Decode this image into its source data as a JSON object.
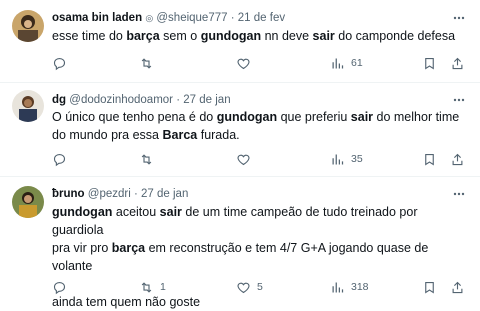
{
  "tweets": [
    {
      "name": "osama bin laden",
      "handle": "@sheique777",
      "sep": "·",
      "date": "21 de fev",
      "body_parts": [
        {
          "t": "esse time do ",
          "b": false
        },
        {
          "t": "barça",
          "b": true
        },
        {
          "t": " sem o ",
          "b": false
        },
        {
          "t": "gundogan",
          "b": true
        },
        {
          "t": " nn deve ",
          "b": false
        },
        {
          "t": "sair",
          "b": true
        },
        {
          "t": " do camponde defesa",
          "b": false
        }
      ],
      "replies": "",
      "retweets": "",
      "likes": "",
      "views": "61"
    },
    {
      "name": "dg",
      "handle": "@dodozinhodoamor",
      "sep": "·",
      "date": "27 de jan",
      "line1": [
        {
          "t": "O único que tenho pena é do ",
          "b": false
        },
        {
          "t": "gundogan",
          "b": true
        },
        {
          "t": " que preferiu ",
          "b": false
        },
        {
          "t": "sair",
          "b": true
        },
        {
          "t": " do melhor time",
          "b": false
        }
      ],
      "line2": [
        {
          "t": "do mundo pra essa ",
          "b": false
        },
        {
          "t": "Barca",
          "b": true
        },
        {
          "t": "  furada.",
          "b": false
        }
      ],
      "replies": "",
      "retweets": "",
      "likes": "",
      "views": "35"
    },
    {
      "name": "ƀruno",
      "handle": "@pezdri",
      "sep": "·",
      "date": "27 de jan",
      "line1": [
        {
          "t": "gundogan",
          "b": true
        },
        {
          "t": " aceitou ",
          "b": false
        },
        {
          "t": "sair",
          "b": true
        },
        {
          "t": " de um time campeão de tudo treinado por guardiola",
          "b": false
        }
      ],
      "line2": [
        {
          "t": "pra vir pro ",
          "b": false
        },
        {
          "t": "barça",
          "b": true
        },
        {
          "t": " em reconstrução e tem 4/7 G+A jogando quase de volante",
          "b": false
        }
      ],
      "line3": "ainda tem quem não goste",
      "replies": "",
      "retweets": "1",
      "likes": "5",
      "views": "318"
    }
  ],
  "icons": {
    "reply": "reply-icon",
    "retweet": "retweet-icon",
    "like": "heart-icon",
    "views": "views-icon",
    "bookmark": "bookmark-icon",
    "share": "share-icon",
    "more": "more-icon"
  },
  "colors": {
    "text": "#0f1419",
    "muted": "#536471",
    "divider": "#eff3f4"
  }
}
